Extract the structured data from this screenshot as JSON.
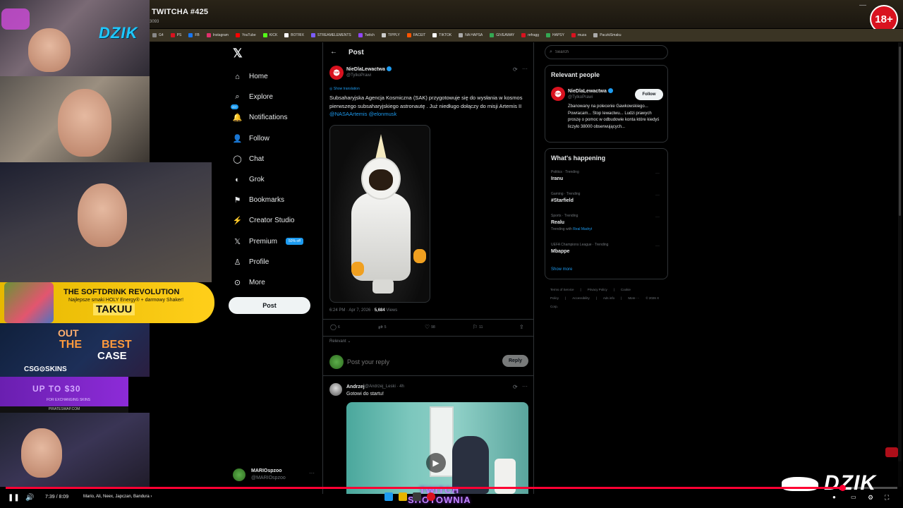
{
  "video": {
    "title": "NAJLEPSZE MOMENTY POLSKIEGO TWITCHA #425",
    "views": "3093",
    "age_badge": "18+",
    "current_time": "7:39",
    "duration": "8:09",
    "time_separator": " / ",
    "chapter": "Mario, Ali, Neex, Japczan, Bandura",
    "chapter_arrow": "›",
    "progress": 0.9386
  },
  "overlays": {
    "dzik_logo_top": "DZIK",
    "dzik_logo_bottom": "DZIK",
    "twitch_banner_line1": "TWITCH",
    "twitch_banner_line2": "SHOTOWNIA",
    "promo1_title": "THE SOFTDRINK REVOLUTION",
    "promo1_sub": "Najlepsze smaki HOLY Energy® + darmowy Shaker!",
    "promo1_brand": "TAKUU",
    "promo2_line1": "OUT",
    "promo2_line2": "THE",
    "promo2_line3": "BEST",
    "promo2_line4": "CASE",
    "promo2_brand": "CSG⊙SKINS",
    "promo3_title": "UP TO $30",
    "promo3_sub": "FOR EXCHANGING SKINS",
    "promo4": "PIRATESWAP.COM"
  },
  "bookmarks": [
    {
      "label": "G4",
      "color": "#888888"
    },
    {
      "label": "PS",
      "color": "#d9121f"
    },
    {
      "label": "FB",
      "color": "#1877f2"
    },
    {
      "label": "Instagram",
      "color": "#e1306c"
    },
    {
      "label": "YouTube",
      "color": "#ff0000"
    },
    {
      "label": "KICK",
      "color": "#53fc18"
    },
    {
      "label": "BOTRIX",
      "color": "#ffffff"
    },
    {
      "label": "STREAMELEMENTS",
      "color": "#7b5cff"
    },
    {
      "label": "Twitch",
      "color": "#9146ff"
    },
    {
      "label": "TIPPLY",
      "color": "#cccccc"
    },
    {
      "label": "FACEIT",
      "color": "#ff5500"
    },
    {
      "label": "TIKTOK",
      "color": "#ffffff"
    },
    {
      "label": "NA HAPSA",
      "color": "#aaaaaa"
    },
    {
      "label": "GIVEAWAY",
      "color": "#34a853"
    },
    {
      "label": "refragg",
      "color": "#d9121f"
    },
    {
      "label": "HAPSY",
      "color": "#34a853"
    },
    {
      "label": "muza",
      "color": "#d9121f"
    },
    {
      "label": "PaczkiSmaku",
      "color": "#aaaaaa"
    }
  ],
  "x_nav": {
    "logo": "𝕏",
    "items": [
      {
        "label": "Home",
        "icon": "⌂"
      },
      {
        "label": "Explore",
        "icon": "⌕"
      },
      {
        "label": "Notifications",
        "icon": "🔔",
        "badge": "20+"
      },
      {
        "label": "Follow",
        "icon": "👤"
      },
      {
        "label": "Chat",
        "icon": "◯"
      },
      {
        "label": "Grok",
        "icon": "◐"
      },
      {
        "label": "Bookmarks",
        "icon": "⚑"
      },
      {
        "label": "Creator Studio",
        "icon": "⚡"
      },
      {
        "label": "Premium",
        "icon": "𝕏",
        "pill": "50% off"
      },
      {
        "label": "Profile",
        "icon": "♙"
      },
      {
        "label": "More",
        "icon": "⊙"
      }
    ],
    "post_button": "Post",
    "account_name": "MARIOspzoo",
    "account_handle": "@MARIOspzoo",
    "account_more": "···"
  },
  "post": {
    "header_title": "Post",
    "back_icon": "←",
    "author_name": "NieDlaLewactwa",
    "author_handle": "@TylkoPrawi",
    "avatar_text": "STOP",
    "show_translation": "Show translation",
    "text_plain": "Subsaharyjska Agencja Kosmiczna (SAK) przygotowuje się do wysłania w kosmos pierwszego subsaharyjskiego astronautę . Już niedługo dołączy do misji Artemis II ",
    "mention1": "@NASAArtemis",
    "mention2": "@elonmusk",
    "timestamp": "6:24 PM · Apr 7, 2026 · ",
    "views_count": "5,684",
    "views_label": " Views",
    "replies": "6",
    "reposts": "5",
    "likes": "98",
    "bookmarks": "11",
    "relevant": "Relevant ⌄",
    "reply_placeholder": "Post your reply",
    "reply_button": "Reply"
  },
  "comment": {
    "name": "Andrzej",
    "handle": "@Andrzej_Leski · 4h",
    "text": "Gotowi do startu!"
  },
  "right": {
    "search_placeholder": "Search",
    "relevant_title": "Relevant people",
    "rel_name": "NieDlaLewactwa",
    "rel_handle": "@TylkoPrawi",
    "rel_avatar_text": "STOP",
    "follow": "Follow",
    "rel_bio": "Zbanowany na polecenie Gawkowskiego... Powracam... Stop lewactwu... Ludzi prawych proszę o pomoc w odbudowie konta które kiedyś liczyło 38000 obserwujących...",
    "happening_title": "What's happening",
    "trends": [
      {
        "category": "Politics · Trending",
        "name": "Iranu",
        "extra_label": "",
        "extra_link": ""
      },
      {
        "category": "Gaming · Trending",
        "name": "#Starfield",
        "extra_label": "",
        "extra_link": ""
      },
      {
        "category": "Sports · Trending",
        "name": "Realu",
        "extra_label": "Trending with ",
        "extra_link": "Real Madryt"
      },
      {
        "category": "UEFA Champions League · Trending",
        "name": "Mbappe",
        "extra_label": "",
        "extra_link": ""
      }
    ],
    "show_more": "Show more",
    "footer": [
      "Terms of Service",
      "|",
      "Privacy Policy",
      "|",
      "Cookie Policy",
      "|",
      "Accessibility",
      "|",
      "Ads info",
      "|",
      "More ···",
      "© 2026 X Corp."
    ]
  },
  "colors": {
    "accent": "#1d9bf0",
    "progress": "#ff0033",
    "age_badge": "#d9121f"
  }
}
